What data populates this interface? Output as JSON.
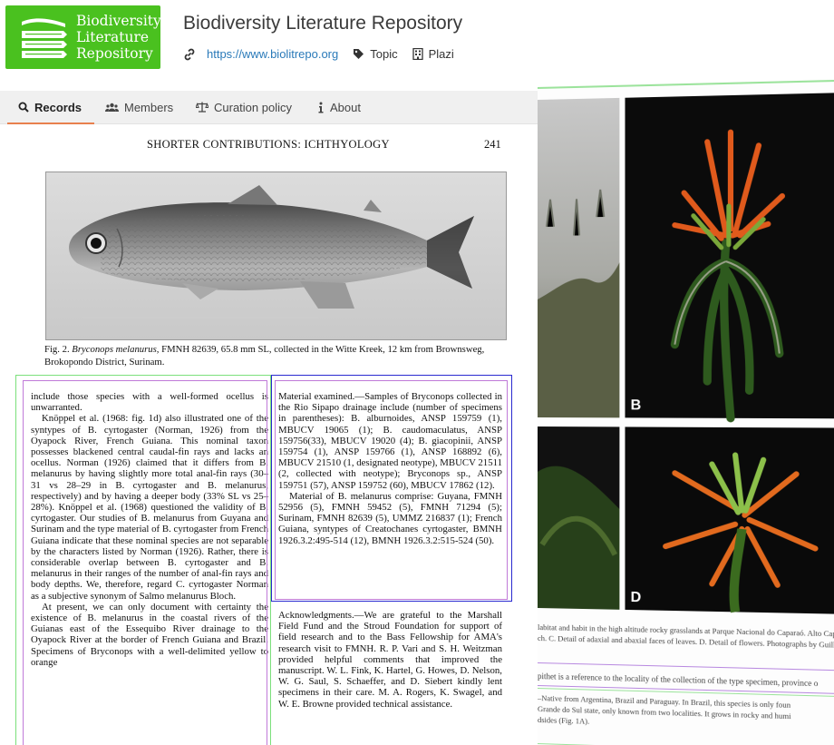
{
  "header": {
    "logo_line1": "Biodiversity",
    "logo_line2": "Literature",
    "logo_line3": "Repository",
    "title": "Biodiversity Literature Repository",
    "url": "https://www.biolitrepo.org",
    "topic_label": "Topic",
    "plazi_label": "Plazi"
  },
  "tabs": [
    {
      "label": "Records",
      "icon": "search-icon",
      "active": true
    },
    {
      "label": "Members",
      "icon": "users-icon",
      "active": false
    },
    {
      "label": "Curation policy",
      "icon": "scale-icon",
      "active": false
    },
    {
      "label": "About",
      "icon": "info-icon",
      "active": false
    }
  ],
  "page": {
    "running_head": "SHORTER CONTRIBUTIONS: ICHTHYOLOGY",
    "page_number": "241",
    "caption": {
      "fig": "Fig. 2.",
      "taxon": "Bryconops melanurus,",
      "rest": "FMNH 82639, 65.8 mm SL, collected in the Witte Kreek, 12 km from Brownsweg, Brokopondo District, Surinam."
    },
    "col1": [
      "include those species with a well-formed ocellus is unwarranted.",
      "Knöppel et al. (1968: fig. 1d) also illustrated one of the syntypes of B. cyrtogaster (Norman, 1926) from the Oyapock River, French Guiana. This nominal taxon possesses blackened central caudal-fin rays and lacks an ocellus. Norman (1926) claimed that it differs from B. melanurus by having slightly more total anal-fin rays (30–31 vs 28–29 in B. cyrtogaster and B. melanurus, respectively) and by having a deeper body (33% SL vs 25–28%). Knöppel et al. (1968) questioned the validity of B. cyrtogaster. Our studies of B. melanurus from Guyana and Surinam and the type material of B. cyrtogaster from French Guiana indicate that these nominal species are not separable by the characters listed by Norman (1926). Rather, there is considerable overlap between B. cyrtogaster and B. melanurus in their ranges of the number of anal-fin rays and body depths. We, therefore, regard C. cyrtogaster Norman as a subjective synonym of Salmo melanurus Bloch.",
      "At present, we can only document with certainty the existence of B. melanurus in the coastal rivers of the Guianas east of the Essequibo River drainage to the Oyapock River at the border of French Guiana and Brazil. Specimens of Bryconops with a well-delimited yellow to orange"
    ],
    "col2": [
      "Material examined.—Samples of Bryconops collected in the Rio Sipapo drainage include (number of specimens in parentheses): B. alburnoides, ANSP 159759 (1), MBUCV 19065 (1); B. caudomaculatus, ANSP 159756(33), MBUCV 19020 (4); B. giacopinii, ANSP 159754 (1), ANSP 159766 (1), ANSP 168892 (6), MBUCV 21510 (1, designated neotype), MBUCV 21511 (2, collected with neotype); Bryconops sp., ANSP 159751 (57), ANSP 159752 (60), MBUCV 17862 (12).",
      "Material of B. melanurus comprise: Guyana, FMNH 52956 (5), FMNH 59452 (5), FMNH 71294 (5); Surinam, FMNH 82639 (5), UMMZ 216837 (1); French Guiana, syntypes of Creatochanes cyrtogaster, BMNH 1926.3.2:495-514 (12), BMNH 1926.3.2:515-524 (50)."
    ],
    "col3": [
      "Acknowledgments.—We are grateful to the Marshall Field Fund and the Stroud Foundation for support of field research and to the Bass Fellowship for AMA's research visit to FMNH. R. P. Vari and S. H. Weitzman provided helpful comments that improved the manuscript. W. L. Fink, K. Hartel, G. Howes, D. Nelson, W. G. Saul, S. Schaeffer, and D. Siebert kindly lent specimens in their care. M. A. Rogers, K. Swagel, and W. E. Browne provided technical assistance."
    ]
  },
  "right_panel": {
    "label_b": "B",
    "label_d": "D",
    "caption_line1": "labitat and habit in the high altitude rocky grasslands at Parque Nacional do Caparaó. Alto Caparaó",
    "caption_line2": "ch. C. Detail of adaxial and abaxial faces of leaves. D. Detail of flowers. Photographs by Guilherme",
    "note_line": "pithet is a reference to the locality of the collection of the type specimen, province o",
    "dist_line1": "–Native from Argentina, Brazil and Paraguay. In Brazil, this species is only foun",
    "dist_line2": "Grande do Sul state, only known from two localities. It grows in rocky and humi",
    "dist_line3": "dsides (Fig. 1A)."
  },
  "colors": {
    "logo_green": "#4ac11f",
    "link_blue": "#2a7ab9",
    "tab_accent": "#e8804e",
    "box_green": "#7be07b",
    "box_purple": "#c07ad8",
    "box_blue": "#2a2ad0"
  }
}
